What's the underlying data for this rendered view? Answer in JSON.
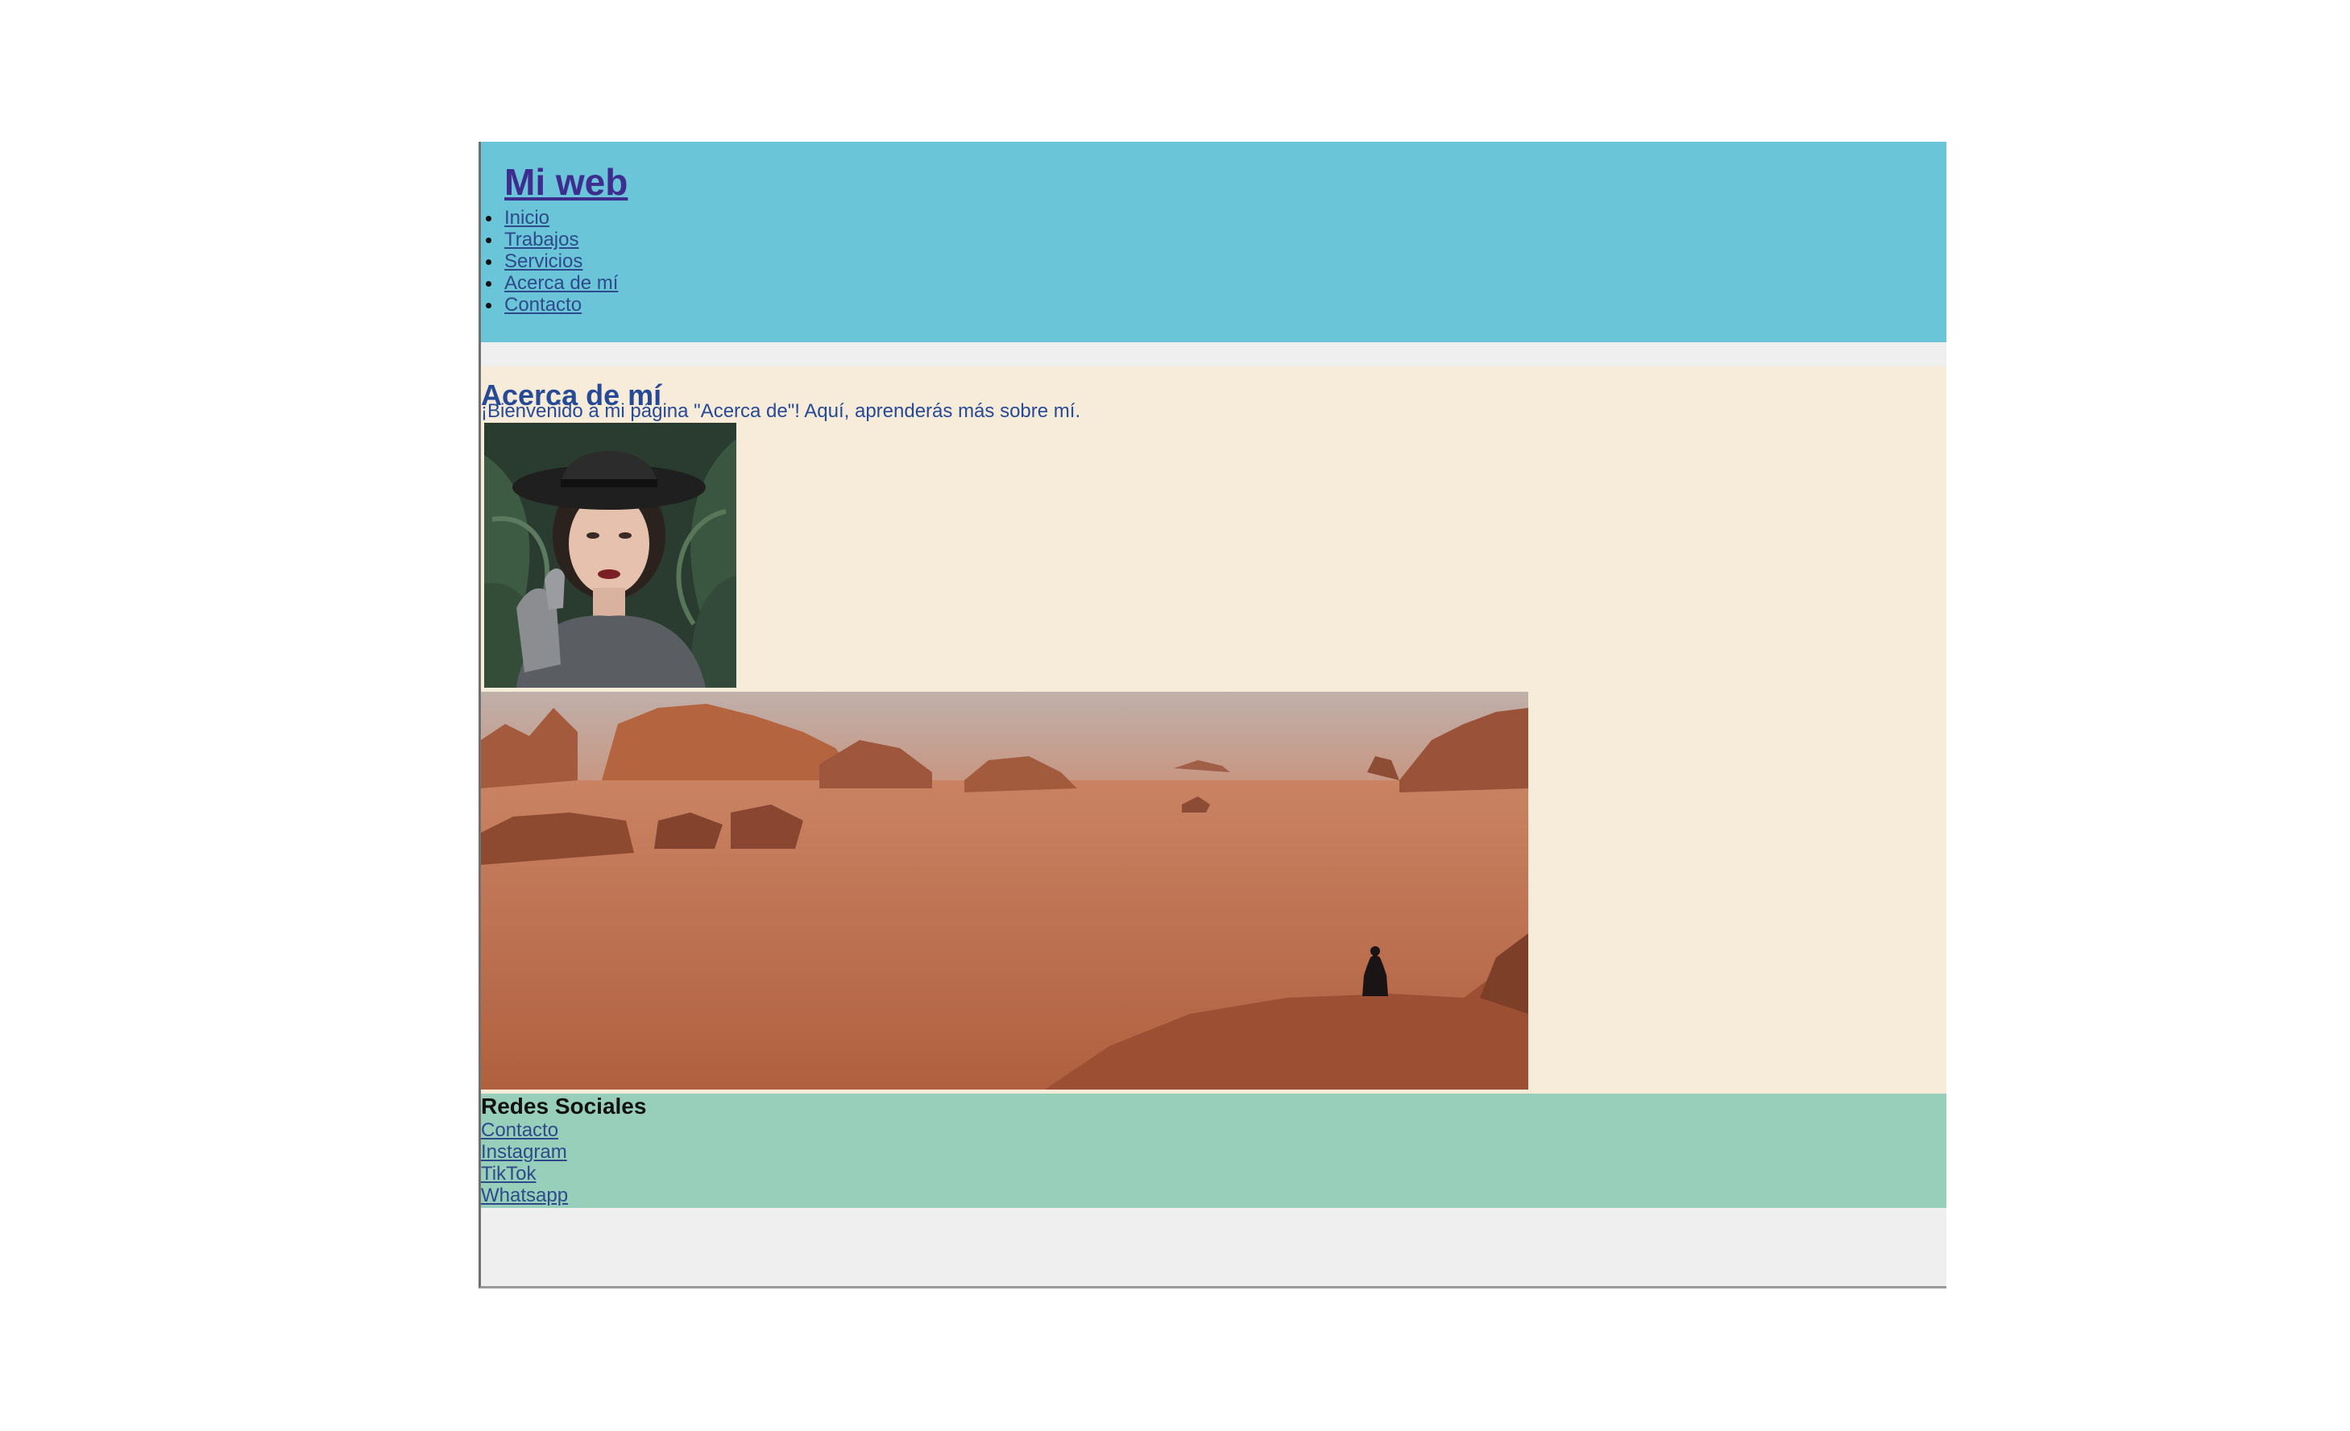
{
  "header": {
    "site_title": "Mi web",
    "nav_items": [
      {
        "label": "Inicio"
      },
      {
        "label": "Trabajos"
      },
      {
        "label": "Servicios"
      },
      {
        "label": "Acerca de mí"
      },
      {
        "label": "Contacto"
      }
    ]
  },
  "about": {
    "title": "Acerca de mí",
    "welcome_text": "¡Bienvenido a mi página \"Acerca de\"! Aquí, aprenderás más sobre mí.",
    "images": [
      {
        "name": "portrait-photo",
        "description_icon": "woman-in-black-hat-photo"
      },
      {
        "name": "desert-landscape-photo",
        "description_icon": "desert-landscape-photo"
      }
    ]
  },
  "footer": {
    "title": "Redes Sociales",
    "links": [
      {
        "label": "Contacto"
      },
      {
        "label": "Instagram"
      },
      {
        "label": "TikTok"
      },
      {
        "label": "Whatsapp"
      }
    ]
  },
  "colors": {
    "header_bg": "#6ac5d9",
    "main_bg": "#f7ebda",
    "footer_bg": "#97cfbb",
    "page_bg": "#efefef",
    "link": "#2e4a8a",
    "title_link": "#3e2d8e",
    "heading": "#264a96"
  }
}
